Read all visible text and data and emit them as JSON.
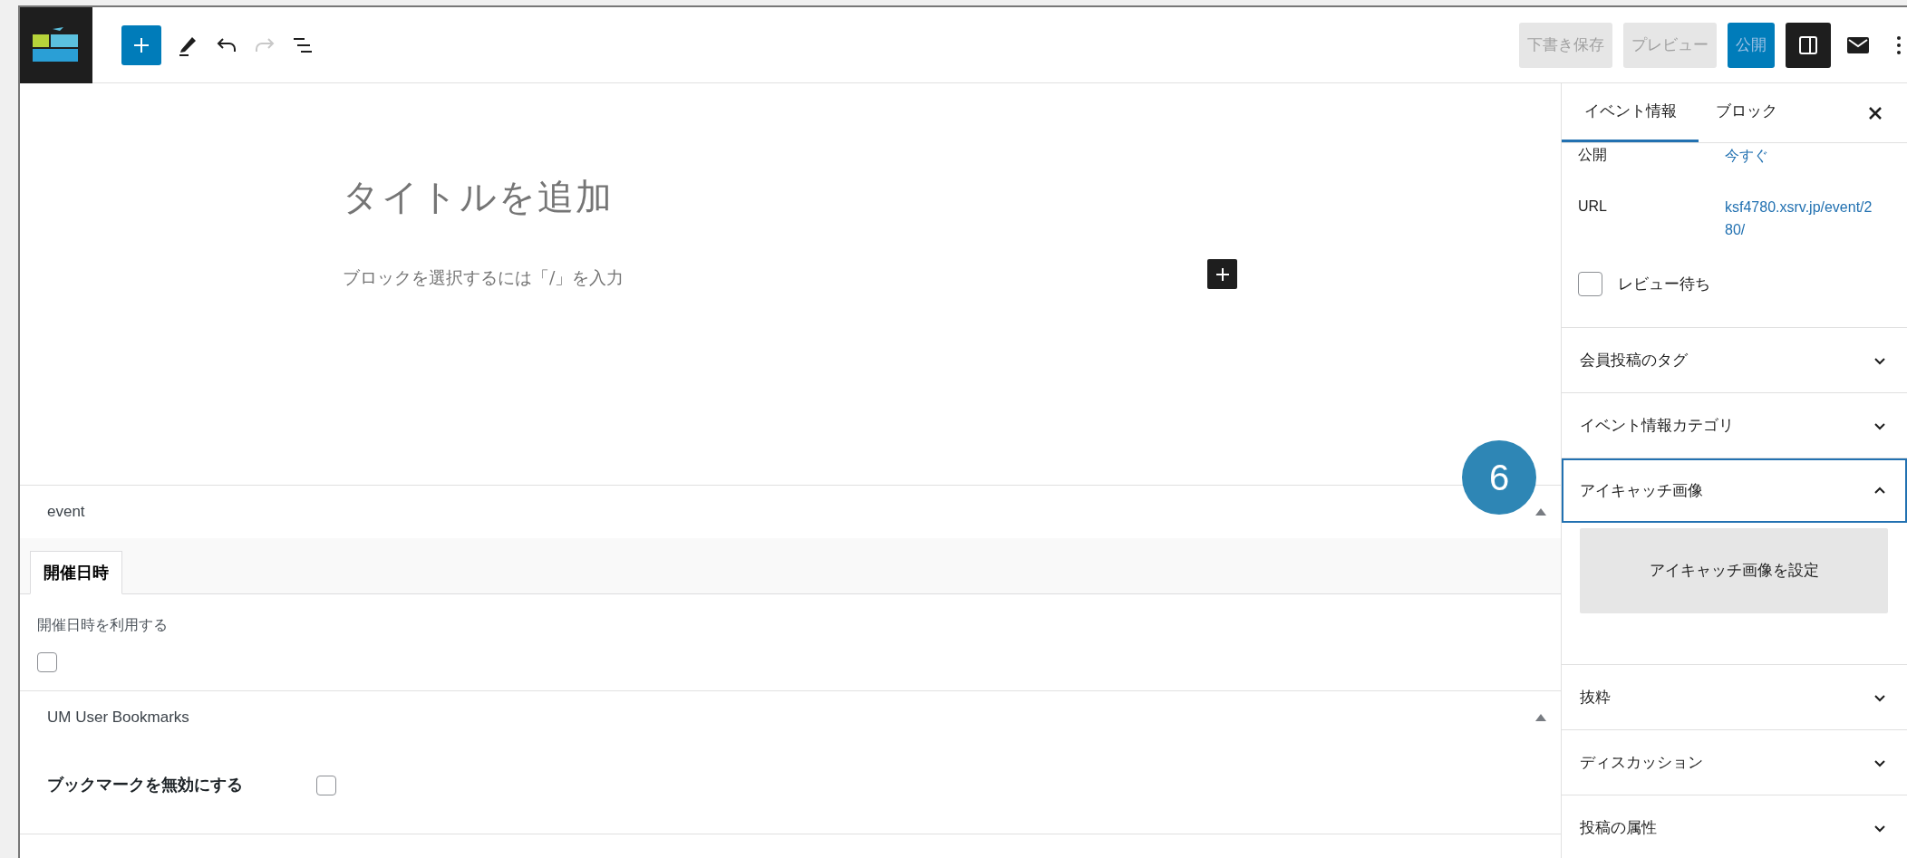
{
  "toolbar": {
    "buttons": [
      {
        "label": "下書き保存",
        "kind": "secondary"
      },
      {
        "label": "プレビュー",
        "kind": "secondary"
      },
      {
        "label": "公開",
        "kind": "primary"
      }
    ]
  },
  "editor": {
    "title_placeholder": "タイトルを追加",
    "block_placeholder": "ブロックを選択するには「/」を入力"
  },
  "meta_boxes": [
    {
      "title": "event",
      "expanded": true,
      "tabs": [
        {
          "label": "開催日時",
          "selected": true
        }
      ],
      "fields": [
        {
          "kind": "stacked",
          "label": "開催日時を利用する",
          "checked": false
        }
      ]
    },
    {
      "title": "UM User Bookmarks",
      "expanded": true,
      "fields": [
        {
          "kind": "inline",
          "label": "ブックマークを無効にする",
          "checked": false
        }
      ]
    }
  ],
  "badge": "6",
  "sidebar": {
    "tabs": [
      {
        "label": "イベント情報",
        "selected": true
      },
      {
        "label": "ブロック",
        "selected": false
      }
    ],
    "status_rows": [
      {
        "label": "公開",
        "value": "今すぐ"
      },
      {
        "label": "URL",
        "value": "ksf4780.xsrv.jp/event/280/"
      }
    ],
    "review": {
      "label": "レビュー待ち",
      "checked": false
    },
    "panels": [
      {
        "title": "会員投稿のタグ",
        "expanded": false,
        "focused": false
      },
      {
        "title": "イベント情報カテゴリ",
        "expanded": false,
        "focused": false
      },
      {
        "title": "アイキャッチ画像",
        "expanded": true,
        "focused": true,
        "button": "アイキャッチ画像を設定"
      },
      {
        "title": "抜粋",
        "expanded": false,
        "focused": false
      },
      {
        "title": "ディスカッション",
        "expanded": false,
        "focused": false
      },
      {
        "title": "投稿の属性",
        "expanded": false,
        "focused": false
      }
    ]
  }
}
